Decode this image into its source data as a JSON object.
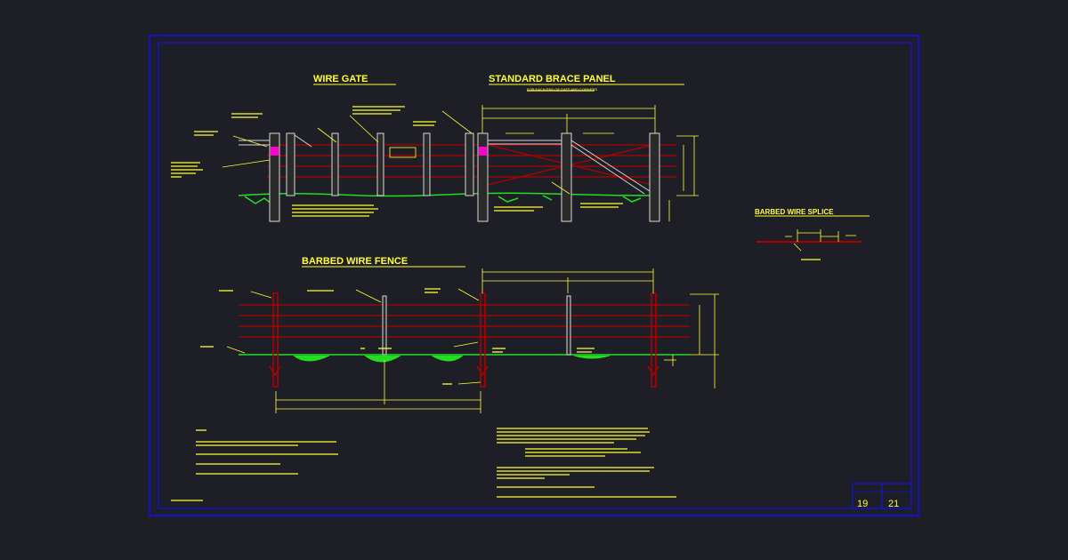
{
  "sheet": {
    "titles": {
      "wire_gate": "WIRE GATE",
      "brace_panel": "STANDARD BRACE PANEL",
      "brace_subtitle": "FOR EACH END OF GATE AND CORNERS",
      "barbed_fence": "BARBED WIRE FENCE",
      "splice": "BARBED WIRE SPLICE"
    },
    "sheet_number": "19",
    "total_sheets": "21"
  },
  "colors": {
    "background": "#1e1f26",
    "border": "#1212c8",
    "wire": "#b00000",
    "ground": "#22dd22",
    "post": "#d8d8d8",
    "annotation": "#ffff33",
    "highlight": "#ff00cc"
  }
}
